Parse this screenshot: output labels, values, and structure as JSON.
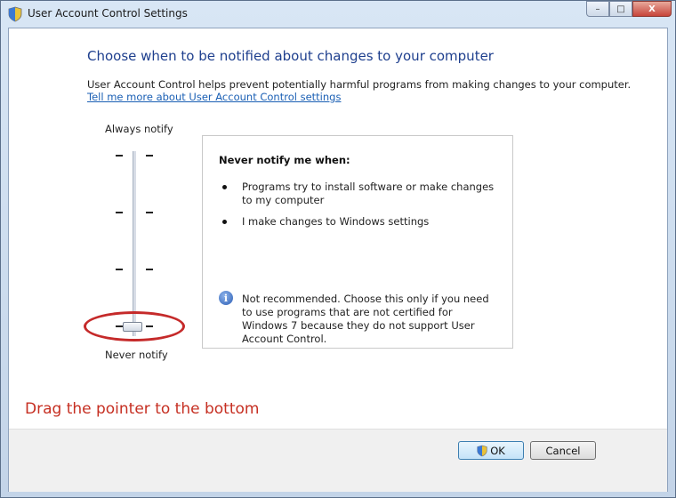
{
  "window": {
    "title": "User Account Control Settings",
    "title_icon": "shield-icon",
    "caption_buttons": {
      "minimize": "–",
      "maximize": "□",
      "close": "X"
    }
  },
  "content": {
    "heading": "Choose when to be notified about changes to your computer",
    "description": "User Account Control helps prevent potentially harmful programs from making changes to your computer.",
    "link": "Tell me more about User Account Control settings"
  },
  "slider": {
    "top_label": "Always notify",
    "bottom_label": "Never notify",
    "level_count": 4,
    "selected_level": "Never notify"
  },
  "info": {
    "title": "Never notify me when:",
    "bullets": [
      "Programs try to install software or make changes to my computer",
      "I make changes to Windows settings"
    ],
    "icon": "info-icon",
    "warning": "Not recommended. Choose this only if you need to use programs that are not certified for Windows 7 because they do not support User Account Control."
  },
  "annotation": {
    "text": "Drag the pointer to the bottom",
    "color": "#c62f22"
  },
  "buttons": {
    "ok": "OK",
    "cancel": "Cancel"
  },
  "colors": {
    "heading": "#1e3f8e",
    "link": "#1a5fb4",
    "highlight_ellipse": "#c52a2a"
  }
}
